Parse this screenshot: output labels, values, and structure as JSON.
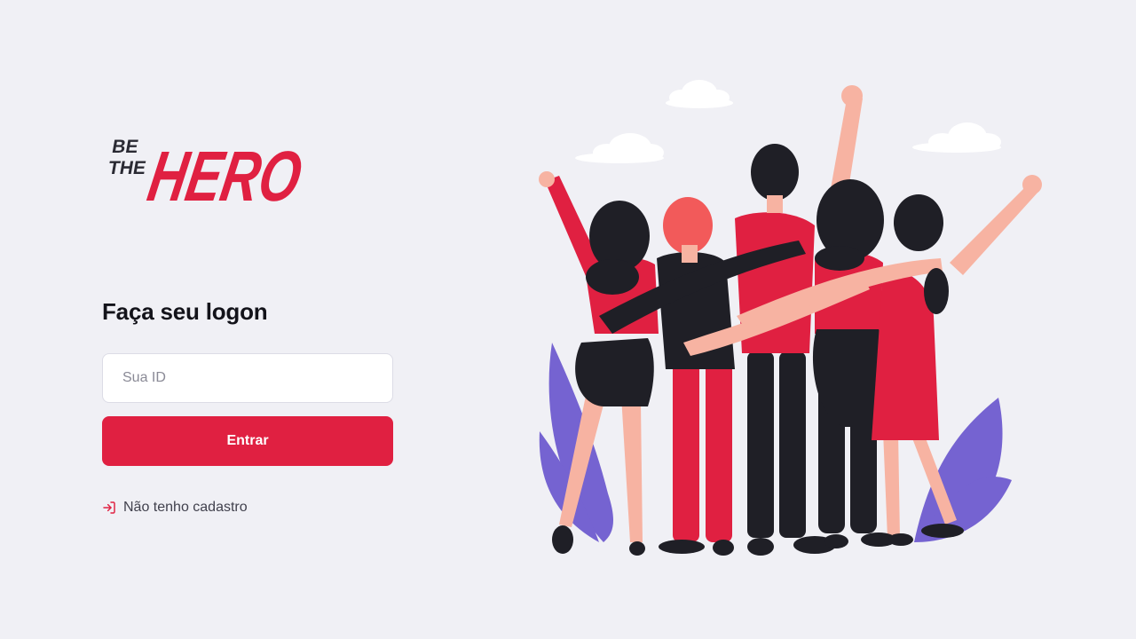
{
  "brand": {
    "line1": "BE",
    "line2": "THE",
    "word": "HERO",
    "accent": "#e02041",
    "dark": "#13131a"
  },
  "logon": {
    "title": "Faça seu logon",
    "id_placeholder": "Sua ID",
    "id_value": "",
    "submit_label": "Entrar",
    "register_link": "Não tenho cadastro"
  },
  "illustration": {
    "name": "group-of-friends-hugging"
  },
  "colors": {
    "background": "#f0f0f5",
    "accent": "#e02041",
    "text": "#13131a",
    "muted": "#41414d"
  }
}
